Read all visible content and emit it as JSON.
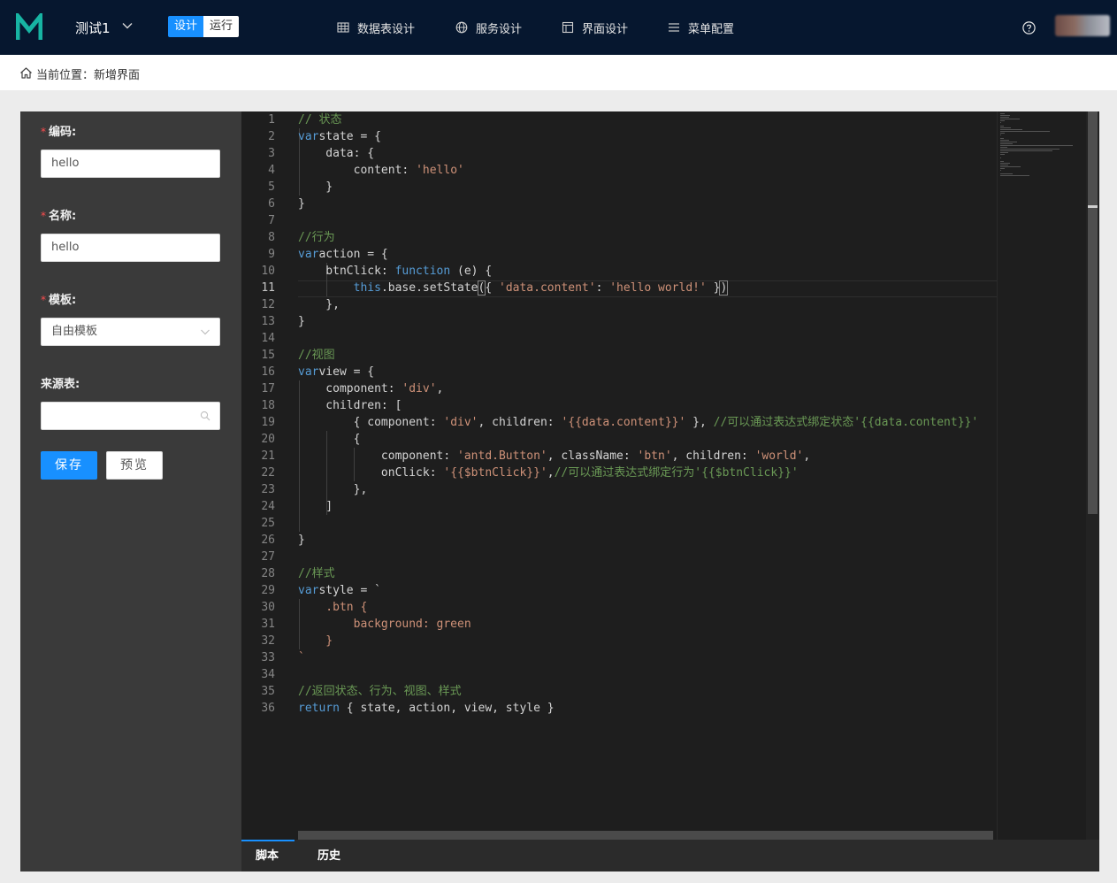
{
  "header": {
    "app_name": "测试1",
    "mode_tabs": {
      "design": "设计",
      "run": "运行"
    },
    "nav": [
      {
        "label": "数据表设计",
        "icon": "table-icon"
      },
      {
        "label": "服务设计",
        "icon": "globe-icon"
      },
      {
        "label": "界面设计",
        "icon": "layout-icon"
      },
      {
        "label": "菜单配置",
        "icon": "menu-icon"
      }
    ],
    "help_icon": "question-circle-icon"
  },
  "breadcrumb": {
    "text": "当前位置：新增界面",
    "icon": "home-icon"
  },
  "form": {
    "code_label": "编码:",
    "code_value": "hello",
    "name_label": "名称:",
    "name_value": "hello",
    "template_label": "模板:",
    "template_value": "自由模板",
    "source_label": "来源表:",
    "source_value": "",
    "required_mark": "*",
    "save_label": "保存",
    "preview_label": "预览"
  },
  "editor": {
    "current_line": 11,
    "lines": [
      [
        [
          "cm",
          "// 状态"
        ]
      ],
      [
        [
          "kw",
          "var"
        ],
        [
          "",
          "state = {"
        ]
      ],
      [
        [
          "",
          "    data: {"
        ]
      ],
      [
        [
          "",
          "        content: "
        ],
        [
          "str",
          "'hello'"
        ]
      ],
      [
        [
          "",
          "    }"
        ]
      ],
      [
        [
          "",
          "}"
        ]
      ],
      [],
      [
        [
          "cm",
          "//行为"
        ]
      ],
      [
        [
          "kw",
          "var"
        ],
        [
          "",
          "action = {"
        ]
      ],
      [
        [
          "",
          "    btnClick: "
        ],
        [
          "kw",
          "function"
        ],
        [
          "",
          " (e) {"
        ]
      ],
      [
        [
          "",
          "        "
        ],
        [
          "kw",
          "this"
        ],
        [
          "",
          ".base.setState"
        ],
        [
          "br",
          "("
        ],
        [
          "",
          "{ "
        ],
        [
          "str",
          "'data.content'"
        ],
        [
          "",
          ": "
        ],
        [
          "str",
          "'hello world!'"
        ],
        [
          "",
          " }"
        ],
        [
          "br",
          ")"
        ]
      ],
      [
        [
          "",
          "    },"
        ]
      ],
      [
        [
          "",
          "}"
        ]
      ],
      [],
      [
        [
          "cm",
          "//视图"
        ]
      ],
      [
        [
          "kw",
          "var"
        ],
        [
          "",
          "view = {"
        ]
      ],
      [
        [
          "",
          "    component: "
        ],
        [
          "str",
          "'div'"
        ],
        [
          "",
          ","
        ]
      ],
      [
        [
          "",
          "    children: ["
        ]
      ],
      [
        [
          "",
          "        { component: "
        ],
        [
          "str",
          "'div'"
        ],
        [
          "",
          ", children: "
        ],
        [
          "str",
          "'{{data.content}}'"
        ],
        [
          "",
          " }, "
        ],
        [
          "cm",
          "//可以通过表达式绑定状态'{{data.content}}'"
        ]
      ],
      [
        [
          "",
          "        {"
        ]
      ],
      [
        [
          "",
          "            component: "
        ],
        [
          "str",
          "'antd.Button'"
        ],
        [
          "",
          ", className: "
        ],
        [
          "str",
          "'btn'"
        ],
        [
          "",
          ", children: "
        ],
        [
          "str",
          "'world'"
        ],
        [
          "",
          ","
        ]
      ],
      [
        [
          "",
          "            onClick: "
        ],
        [
          "str",
          "'{{$btnClick}}'"
        ],
        [
          "",
          ","
        ],
        [
          "cm",
          "//可以通过表达式绑定行为'{{$btnClick}}'"
        ]
      ],
      [
        [
          "",
          "        },"
        ]
      ],
      [
        [
          "",
          "    ]"
        ]
      ],
      [],
      [
        [
          "",
          "}"
        ]
      ],
      [],
      [
        [
          "cm",
          "//样式"
        ]
      ],
      [
        [
          "kw",
          "var"
        ],
        [
          "",
          "style = `"
        ]
      ],
      [
        [
          "str",
          "    .btn {"
        ]
      ],
      [
        [
          "str",
          "        background: green"
        ]
      ],
      [
        [
          "str",
          "    }"
        ]
      ],
      [
        [
          "str",
          "`"
        ]
      ],
      [],
      [
        [
          "cm",
          "//返回状态、行为、视图、样式"
        ]
      ],
      [
        [
          "kw",
          "return"
        ],
        [
          "",
          " { state, action, view, style }"
        ]
      ]
    ]
  },
  "bottom_tabs": {
    "script": "脚本",
    "history": "历史"
  }
}
